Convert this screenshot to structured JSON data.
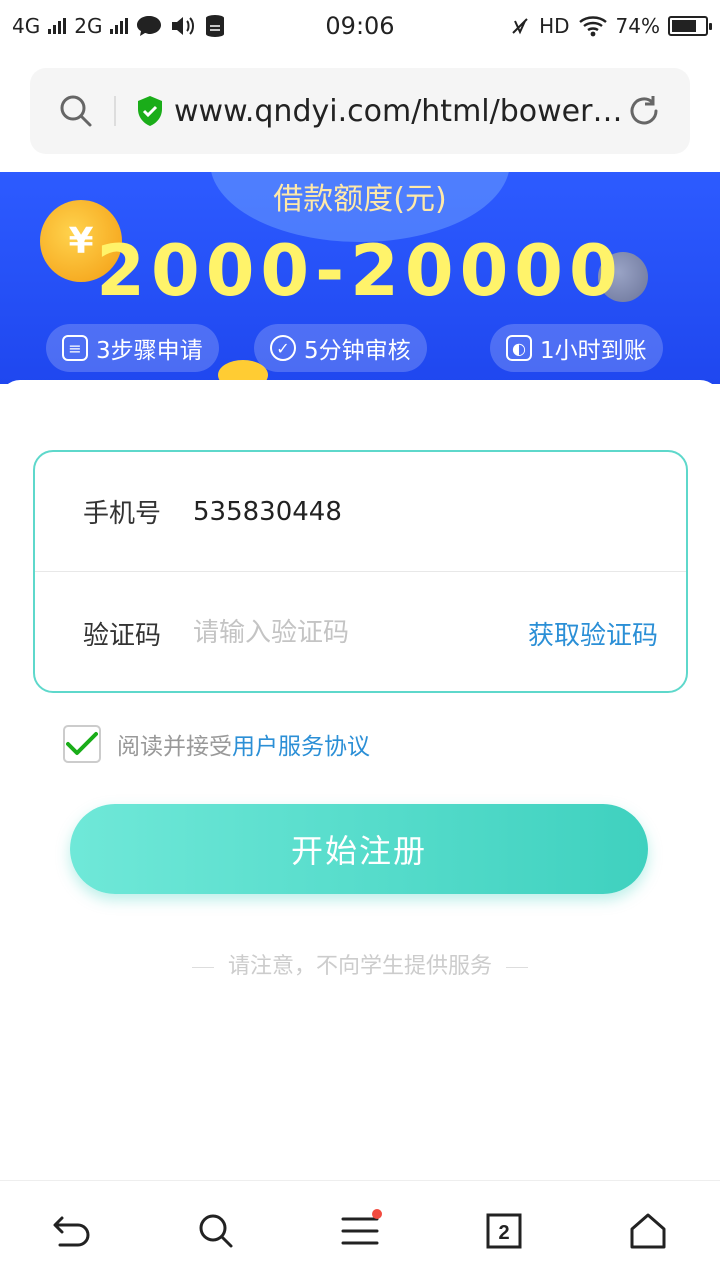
{
  "status_bar": {
    "network_1": "4G",
    "network_2": "2G",
    "time": "09:06",
    "hd_label": "HD",
    "battery_percent": "74%",
    "battery_level": 0.74
  },
  "url_bar": {
    "url": "www.qndyi.com/html/bower/…"
  },
  "banner": {
    "title": "借款额度(元)",
    "amount": "2000-20000",
    "coin_symbol": "¥",
    "features": [
      {
        "label": "3步骤申请"
      },
      {
        "label": "5分钟审核"
      },
      {
        "label": "1小时到账"
      }
    ]
  },
  "form": {
    "phone_label": "手机号",
    "phone_value": "535830448",
    "code_label": "验证码",
    "code_placeholder": "请输入验证码",
    "get_code_label": "获取验证码"
  },
  "agreement": {
    "text": "阅读并接受",
    "link": "用户服务协议",
    "checked": true
  },
  "register_button": "开始注册",
  "notice": "请注意，不向学生提供服务",
  "bottom_nav": {
    "tab_count": "2",
    "menu_has_badge": true
  },
  "colors": {
    "accent_teal": "#3fd1bf",
    "link_blue": "#2b8fd6",
    "banner_blue": "#1f47ef",
    "amount_yellow": "#fff36a",
    "badge_red": "#f24b3f",
    "check_green": "#1aad19"
  },
  "icons": {
    "url_search": "search-icon",
    "secure": "shield-check-icon",
    "reload": "refresh-icon",
    "nav": [
      "back-icon",
      "search-icon",
      "menu-icon",
      "tabs-icon",
      "home-icon"
    ]
  }
}
